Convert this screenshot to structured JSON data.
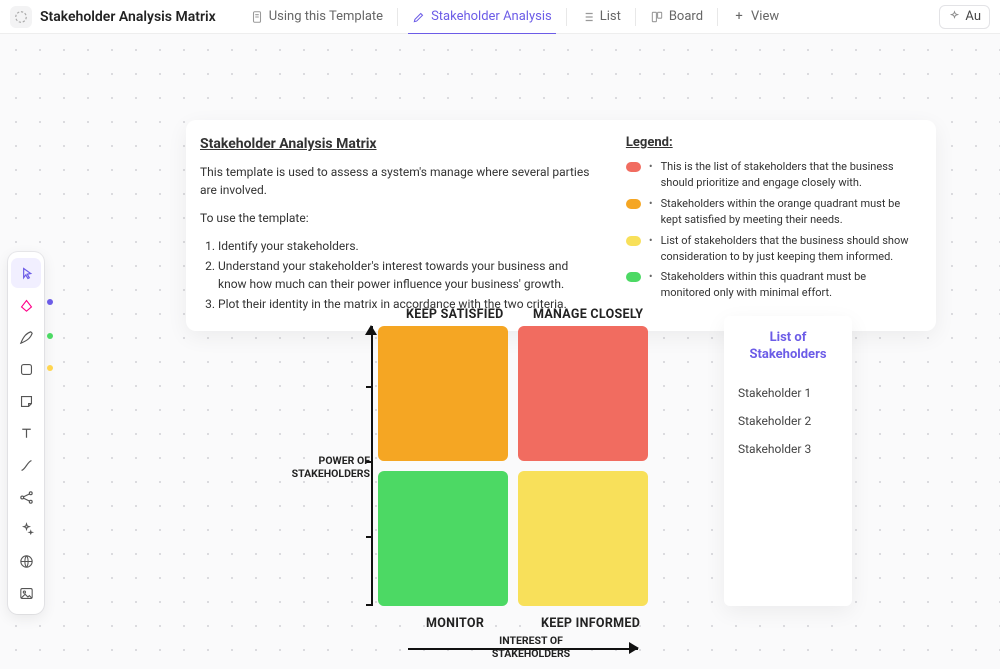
{
  "header": {
    "title": "Stakeholder Analysis Matrix",
    "tabs": [
      {
        "label": "Using this Template",
        "icon": "doc"
      },
      {
        "label": "Stakeholder Analysis",
        "icon": "edit",
        "active": true
      },
      {
        "label": "List",
        "icon": "list"
      },
      {
        "label": "Board",
        "icon": "board"
      }
    ],
    "addView": "View",
    "autoBtn": "Au"
  },
  "toolbar": {
    "tools": [
      "pointer",
      "note",
      "pen",
      "shape",
      "sticky",
      "text",
      "connector",
      "share",
      "sparkle",
      "globe",
      "image"
    ]
  },
  "info": {
    "title": "Stakeholder Analysis Matrix",
    "desc": "This template is used to assess a system's manage where several parties are involved.",
    "usage": "To use the template:",
    "steps": [
      "Identify your stakeholders.",
      "Understand your stakeholder's interest towards your business and know how much can their power influence your business' growth.",
      "Plot their identity in the matrix in accordance with the two criteria."
    ],
    "legendTitle": "Legend:",
    "legend": [
      {
        "color": "#f16c60",
        "text": "This is the list of stakeholders that the business should prioritize and engage closely with."
      },
      {
        "color": "#f5a623",
        "text": "Stakeholders within the orange quadrant must be kept satisfied by meeting their needs."
      },
      {
        "color": "#f8e05a",
        "text": "List of stakeholders that the business should show consideration to by just keeping them informed."
      },
      {
        "color": "#4cd964",
        "text": "Stakeholders within this quadrant must be monitored only with minimal effort."
      }
    ]
  },
  "matrix": {
    "q_tl": "KEEP SATISFIED",
    "q_tr": "MANAGE CLOSELY",
    "q_bl": "MONITOR",
    "q_br": "KEEP INFORMED",
    "y_label": "POWER OF STAKEHOLDERS",
    "x_label": "INTEREST OF STAKEHOLDERS"
  },
  "stakeholders": {
    "title": "List of Stakeholders",
    "items": [
      "Stakeholder 1",
      "Stakeholder 2",
      "Stakeholder 3"
    ]
  }
}
